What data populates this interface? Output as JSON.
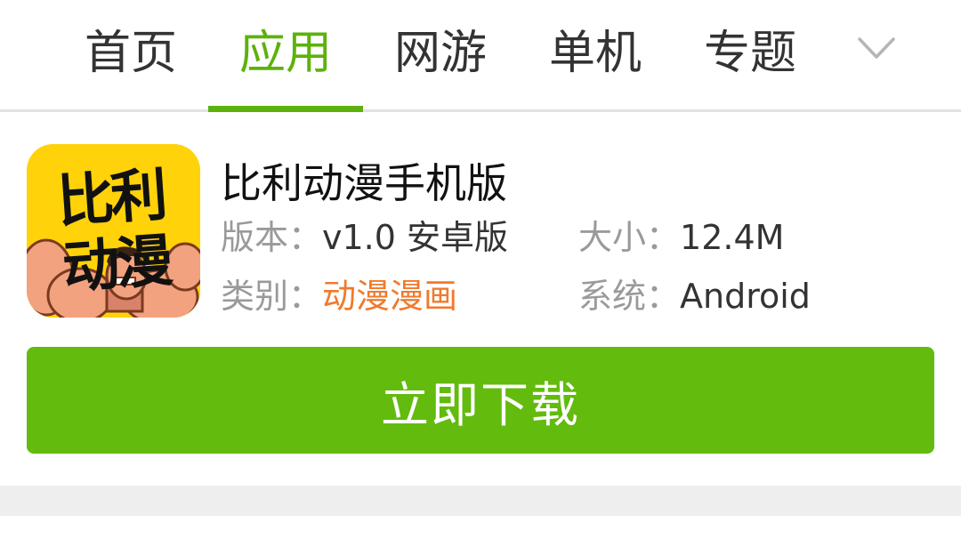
{
  "nav": {
    "tabs": [
      {
        "label": "首页",
        "active": false
      },
      {
        "label": "应用",
        "active": true
      },
      {
        "label": "网游",
        "active": false
      },
      {
        "label": "单机",
        "active": false
      },
      {
        "label": "专题",
        "active": false
      }
    ],
    "more_icon": "chevron-down-icon"
  },
  "app": {
    "icon_text_top": "比利",
    "icon_text_bottom": "动漫",
    "title": "比利动漫手机版",
    "version_key": "版本：",
    "version_value": "v1.0 安卓版",
    "size_key": "大小：",
    "size_value": "12.4M",
    "category_key": "类别：",
    "category_value": "动漫漫画",
    "system_key": "系统：",
    "system_value": "Android"
  },
  "download": {
    "label": "立即下载"
  },
  "colors": {
    "accent_green": "#5cb20b",
    "button_green": "#62bb0d",
    "category_orange": "#f07a2c",
    "icon_yellow": "#ffd20a"
  }
}
